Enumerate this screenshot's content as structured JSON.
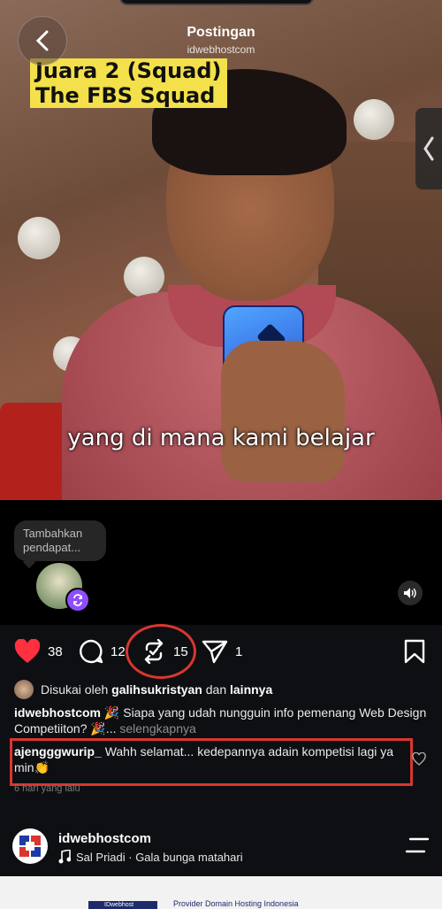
{
  "header": {
    "title": "Postingan",
    "subtitle": "idwebhostcom"
  },
  "video": {
    "caption_lines": [
      "Juara 2 (Squad)",
      "The FBS Squad"
    ],
    "subtitle": "yang di mana kami belajar"
  },
  "story": {
    "bubble_text": "Tambahkan pendapat..."
  },
  "actions": {
    "likes": "38",
    "comments": "12",
    "reposts": "15",
    "shares": "1"
  },
  "liked_by": {
    "prefix": "Disukai oleh",
    "user": "galihsukristyan",
    "joiner": "dan",
    "others": "lainnya"
  },
  "post": {
    "username": "idwebhostcom",
    "text": "🎉 Siapa yang udah nungguin info pemenang Web Design Competiiton? 🎉...",
    "more_label": "selengkapnya"
  },
  "comment": {
    "username": "ajengggwurip_",
    "text": "Wahh selamat... kedepannya adain kompetisi lagi ya min👏"
  },
  "time_ago": "6 hari yang lalu",
  "account": {
    "name": "idwebhostcom",
    "music": "Sal Priadi · Gala bunga matahari"
  },
  "footer": {
    "logo_text": "IDwebhost",
    "text": "Provider Domain Hosting Indonesia"
  },
  "colors": {
    "like_red": "#ff3040",
    "highlight": "#d9362f",
    "repost_badge": "#8f4dff"
  }
}
